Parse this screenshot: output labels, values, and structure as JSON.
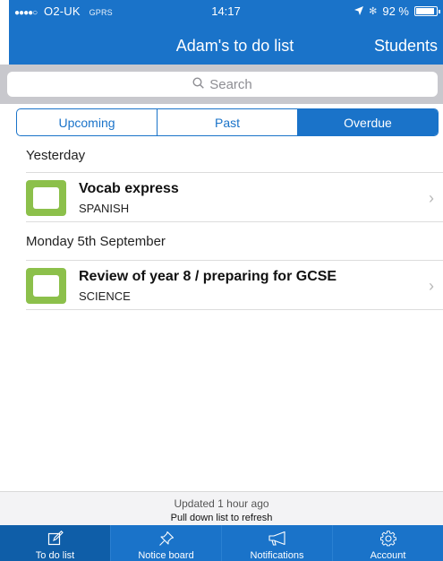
{
  "status_bar": {
    "carrier": "O2-UK",
    "network": "GPRS",
    "time": "14:17",
    "battery": "92 %",
    "battery_level": 0.92
  },
  "nav": {
    "title": "Adam's to do list",
    "students_label": "Students"
  },
  "search": {
    "placeholder": "Search"
  },
  "segments": {
    "upcoming": "Upcoming",
    "past": "Past",
    "overdue": "Overdue",
    "active": "Overdue"
  },
  "groups": [
    {
      "header": "Yesterday",
      "tasks": [
        {
          "title": "Vocab express",
          "subject": "SPANISH",
          "color": "#8cc04b"
        }
      ]
    },
    {
      "header": "Monday 5th September",
      "tasks": [
        {
          "title": "Review of year 8 / preparing for GCSE",
          "subject": "SCIENCE",
          "color": "#8cc04b"
        }
      ]
    }
  ],
  "footer": {
    "updated": "Updated 1 hour ago",
    "pull_hint": "Pull down list to refresh"
  },
  "tabs": [
    {
      "label": "To do list",
      "icon": "edit-icon",
      "active": true
    },
    {
      "label": "Notice board",
      "icon": "pin-icon",
      "active": false
    },
    {
      "label": "Notifications",
      "icon": "megaphone-icon",
      "active": false
    },
    {
      "label": "Account",
      "icon": "gear-icon",
      "active": false
    }
  ],
  "colors": {
    "brand_blue": "#1a73c9",
    "active_tab": "#0f5ea8",
    "subject_green": "#8cc04b"
  }
}
